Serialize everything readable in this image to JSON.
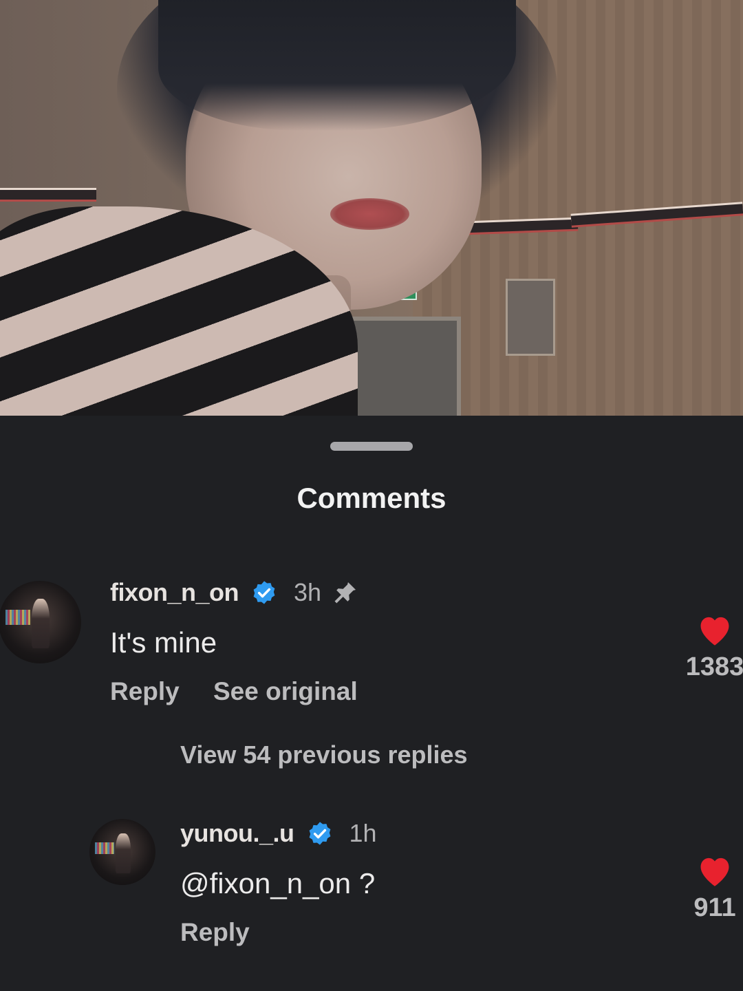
{
  "sheet": {
    "title": "Comments"
  },
  "comments": [
    {
      "username": "fixon_n_on",
      "time": "3h",
      "text": "It's mine",
      "reply_label": "Reply",
      "see_original_label": "See original",
      "likes": "1383"
    }
  ],
  "view_previous_replies": "View 54 previous replies",
  "replies": [
    {
      "username": "yunou._.u",
      "time": "1h",
      "text": "@fixon_n_on ?",
      "reply_label": "Reply",
      "likes": "911"
    }
  ],
  "colors": {
    "sheet_bg": "#1f2023",
    "verified_blue": "#2f9bf0",
    "like_red": "#e8222e"
  },
  "icons": [
    "verified-icon",
    "pin-icon",
    "heart-icon"
  ]
}
